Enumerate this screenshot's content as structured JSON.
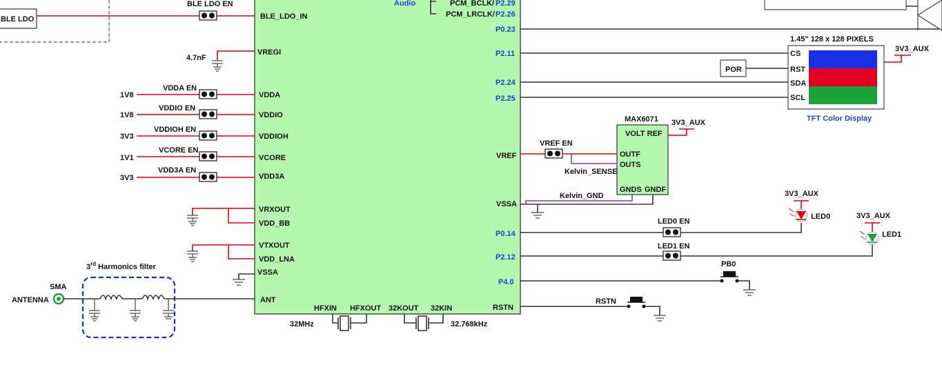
{
  "ble_ldo": {
    "box_label": "BLE LDO",
    "jumper_label": "BLE LDO EN"
  },
  "mcu": {
    "audio_label": "Audio",
    "left_pins": [
      "BLE_LDO_IN",
      "VREGI",
      "VDDA",
      "VDDIO",
      "VDDIOH",
      "VCORE",
      "VDD3A",
      "VRXOUT",
      "VDD_BB",
      "VTXOUT",
      "VDD_LNA",
      "VSSA",
      "ANT"
    ],
    "right_pins": [
      "P0.23",
      "P2.11",
      "P2.24",
      "P2.25",
      "VREF",
      "VSSA",
      "P0.14",
      "P2.12",
      "P4.0",
      "RSTN"
    ],
    "pcm_bclk": "PCM_BCLK/",
    "pcm_bclk_pin": "P2.29",
    "pcm_lrclk": "PCM_LRCLK/",
    "pcm_lrclk_pin": "P2.26",
    "bottom_pins": [
      "HFXIN",
      "HFXOUT",
      "32KOUT",
      "32KIN"
    ]
  },
  "cap_vregi": "4.7nF",
  "supply_rails": [
    {
      "voltage": "1V8",
      "jumper": "VDDA EN"
    },
    {
      "voltage": "1V8",
      "jumper": "VDDIO EN"
    },
    {
      "voltage": "3V3",
      "jumper": "VDDIOH EN"
    },
    {
      "voltage": "1V1",
      "jumper": "VCORE EN"
    },
    {
      "voltage": "3V3",
      "jumper": "VDD3A EN"
    }
  ],
  "crystals": {
    "hf": "32MHz",
    "lf": "32.768kHz"
  },
  "antenna": {
    "connector": "SMA",
    "label": "ANTENNA",
    "filter_prefix": "3",
    "filter_sup": "rd",
    "filter_suffix": " Harmonics filter"
  },
  "display": {
    "title": "1.45\" 128 x 128 PIXELS",
    "pins": [
      "CS",
      "RST",
      "SDA",
      "SCL"
    ],
    "caption": "TFT Color Display",
    "supply": "3V3_AUX",
    "por_label": "POR",
    "stripe_colors": [
      "#1a2fe8",
      "#e5001f",
      "#17a33a"
    ]
  },
  "vref_ic": {
    "part": "MAX6071",
    "supply": "3V3_AUX",
    "pins": [
      "VOLT REF",
      "OUTF",
      "OUTS",
      "GNDS",
      "GNDF"
    ],
    "jumper": "VREF EN",
    "kelvin_sense": "Kelvin_SENSE",
    "kelvin_gnd": "Kelvin_GND"
  },
  "leds": [
    {
      "name": "LED0",
      "supply": "3V3_AUX",
      "jumper": "LED0 EN",
      "color": "#e00000"
    },
    {
      "name": "LED1",
      "supply": "3V3_AUX",
      "jumper": "LED1 EN",
      "color": "#17a33a"
    }
  ],
  "buttons": {
    "pb0": "PB0",
    "rstn": "RSTN"
  },
  "colors": {
    "mcu_fill": "#b6f7b0",
    "wire_red": "#e00000",
    "pin_blue": "#1f3fcf",
    "filter_border": "#1030d0",
    "kelvin_purple": "#7a3fb0"
  }
}
